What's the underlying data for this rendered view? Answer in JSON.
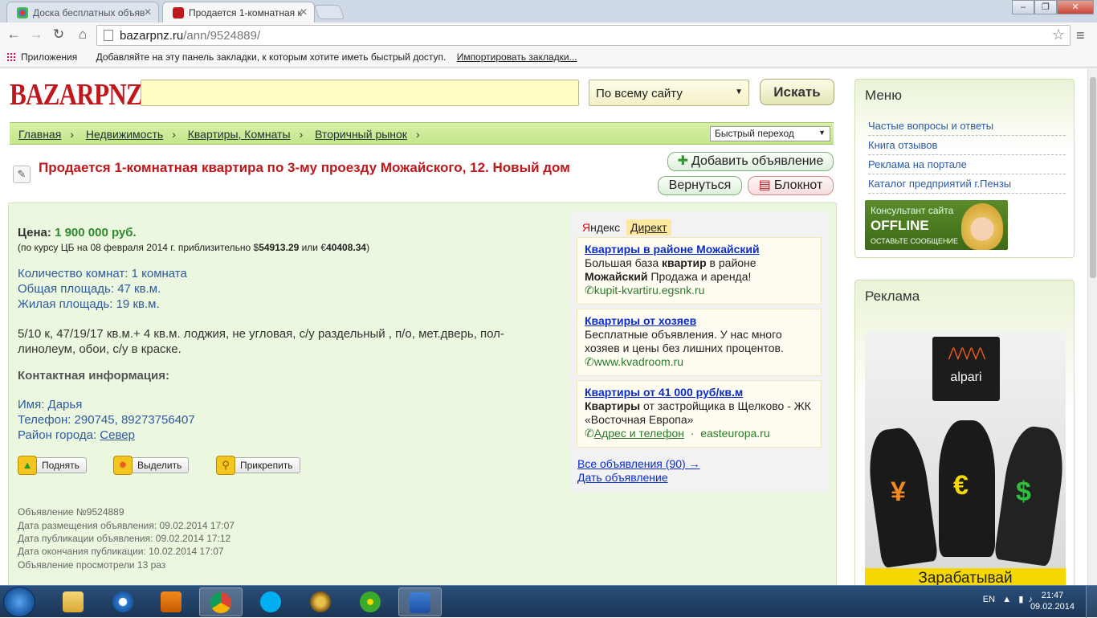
{
  "browser": {
    "tabs": [
      {
        "title": "Доска бесплатных объяв",
        "active": false
      },
      {
        "title": "Продается 1-комнатная к",
        "active": true
      }
    ],
    "address": {
      "host": "bazarpnz.ru",
      "path": "/ann/9524889/"
    },
    "bookmarks": {
      "apps": "Приложения",
      "hint": "Добавляйте на эту панель закладки, к которым хотите иметь быстрый доступ.",
      "import": "Импортировать закладки..."
    }
  },
  "header": {
    "logo": "BAZARPNZ.RU",
    "search_value": "",
    "scope": "По всему сайту",
    "search_button": "Искать"
  },
  "breadcrumb": {
    "items": [
      "Главная",
      "Недвижимость",
      "Квартиры, Комнаты",
      "Вторичный рынок"
    ],
    "quick_jump": "Быстрый переход"
  },
  "listing": {
    "title": "Продается 1-комнатная квартира по 3-му проезду Можайского, 12. Новый дом",
    "add_button": "Добавить объявление",
    "back_button": "Вернуться",
    "notepad_button": "Блокнот",
    "price_label": "Цена:",
    "price_value": "1 900 000 руб.",
    "rate_prefix": "(по курсу ЦБ на 08 февраля 2014 г. приблизительно $",
    "rate_usd": "54913.29",
    "rate_mid": " или €",
    "rate_eur": "40408.34",
    "rate_suffix": ")",
    "rooms": "Количество комнат: 1 комната",
    "total_area": "Общая площадь: 47 кв.м.",
    "living_area": "Жилая площадь: 19 кв.м.",
    "description": "5/10 к, 47/19/17 кв.м.+ 4 кв.м. лоджия, не угловая, с/у раздельный , п/о, мет.дверь, пол-линолеум, обои, с/у в краске.",
    "contact_header": "Контактная информация:",
    "name": "Имя: Дарья",
    "phone": "Телефон: 290745, 89273756407",
    "district_label": "Район города: ",
    "district_value": "Север",
    "actions": {
      "raise": "Поднять",
      "highlight": "Выделить",
      "pin": "Прикрепить"
    },
    "meta": {
      "id": "Объявление №9524889",
      "posted": "Дата размещения объявления: 09.02.2014  17:07",
      "published": "Дата публикации объявления: 09.02.2014  17:12",
      "ends": "Дата окончания публикации: 10.02.2014 17:07",
      "views": "Объявление просмотрели 13 раз"
    }
  },
  "yandex": {
    "tab_ya_first": "Я",
    "tab_ya_rest": "ндекс",
    "tab_direct": "Директ",
    "ads": [
      {
        "title": "Квартиры в районе Можайский",
        "text1": "Большая база ",
        "bold1": "квартир",
        "text2": " в районе ",
        "bold2": "Можайский",
        "text3": " Продажа и аренда!",
        "url": "kupit-kvartiru.egsnk.ru"
      },
      {
        "title": "Квартиры от хозяев",
        "text": "Бесплатные объявления. У нас много хозяев и цены без лишних процентов.",
        "url": "www.kvadroom.ru"
      },
      {
        "title": "Квартиры от 41 000 руб/кв.м",
        "bold": "Квартиры",
        "text": " от застройщика в Щелково - ЖК «Восточная Европа»",
        "link": "Адрес и телефон",
        "dot": "·",
        "url": "easteuropa.ru"
      }
    ],
    "all_ads": "Все объявления (90) →",
    "post_ad": "Дать объявление"
  },
  "sidebar": {
    "menu_title": "Меню",
    "menu_items": [
      "Частые вопросы и ответы",
      "Книга отзывов",
      "Реклама на портале",
      "Каталог предприятий г.Пензы"
    ],
    "consultant": {
      "line1": "Консультант сайта",
      "line2": "OFFLINE",
      "line3": "ОСТАВЬТЕ СООБЩЕНИЕ"
    },
    "ad_title": "Реклама",
    "banner": {
      "brand": "alpari",
      "currencies": [
        "¥",
        "€",
        "$"
      ],
      "cta": "Зарабатывай"
    }
  },
  "taskbar": {
    "lang": "EN",
    "time": "21:47",
    "date": "09.02.2014"
  }
}
